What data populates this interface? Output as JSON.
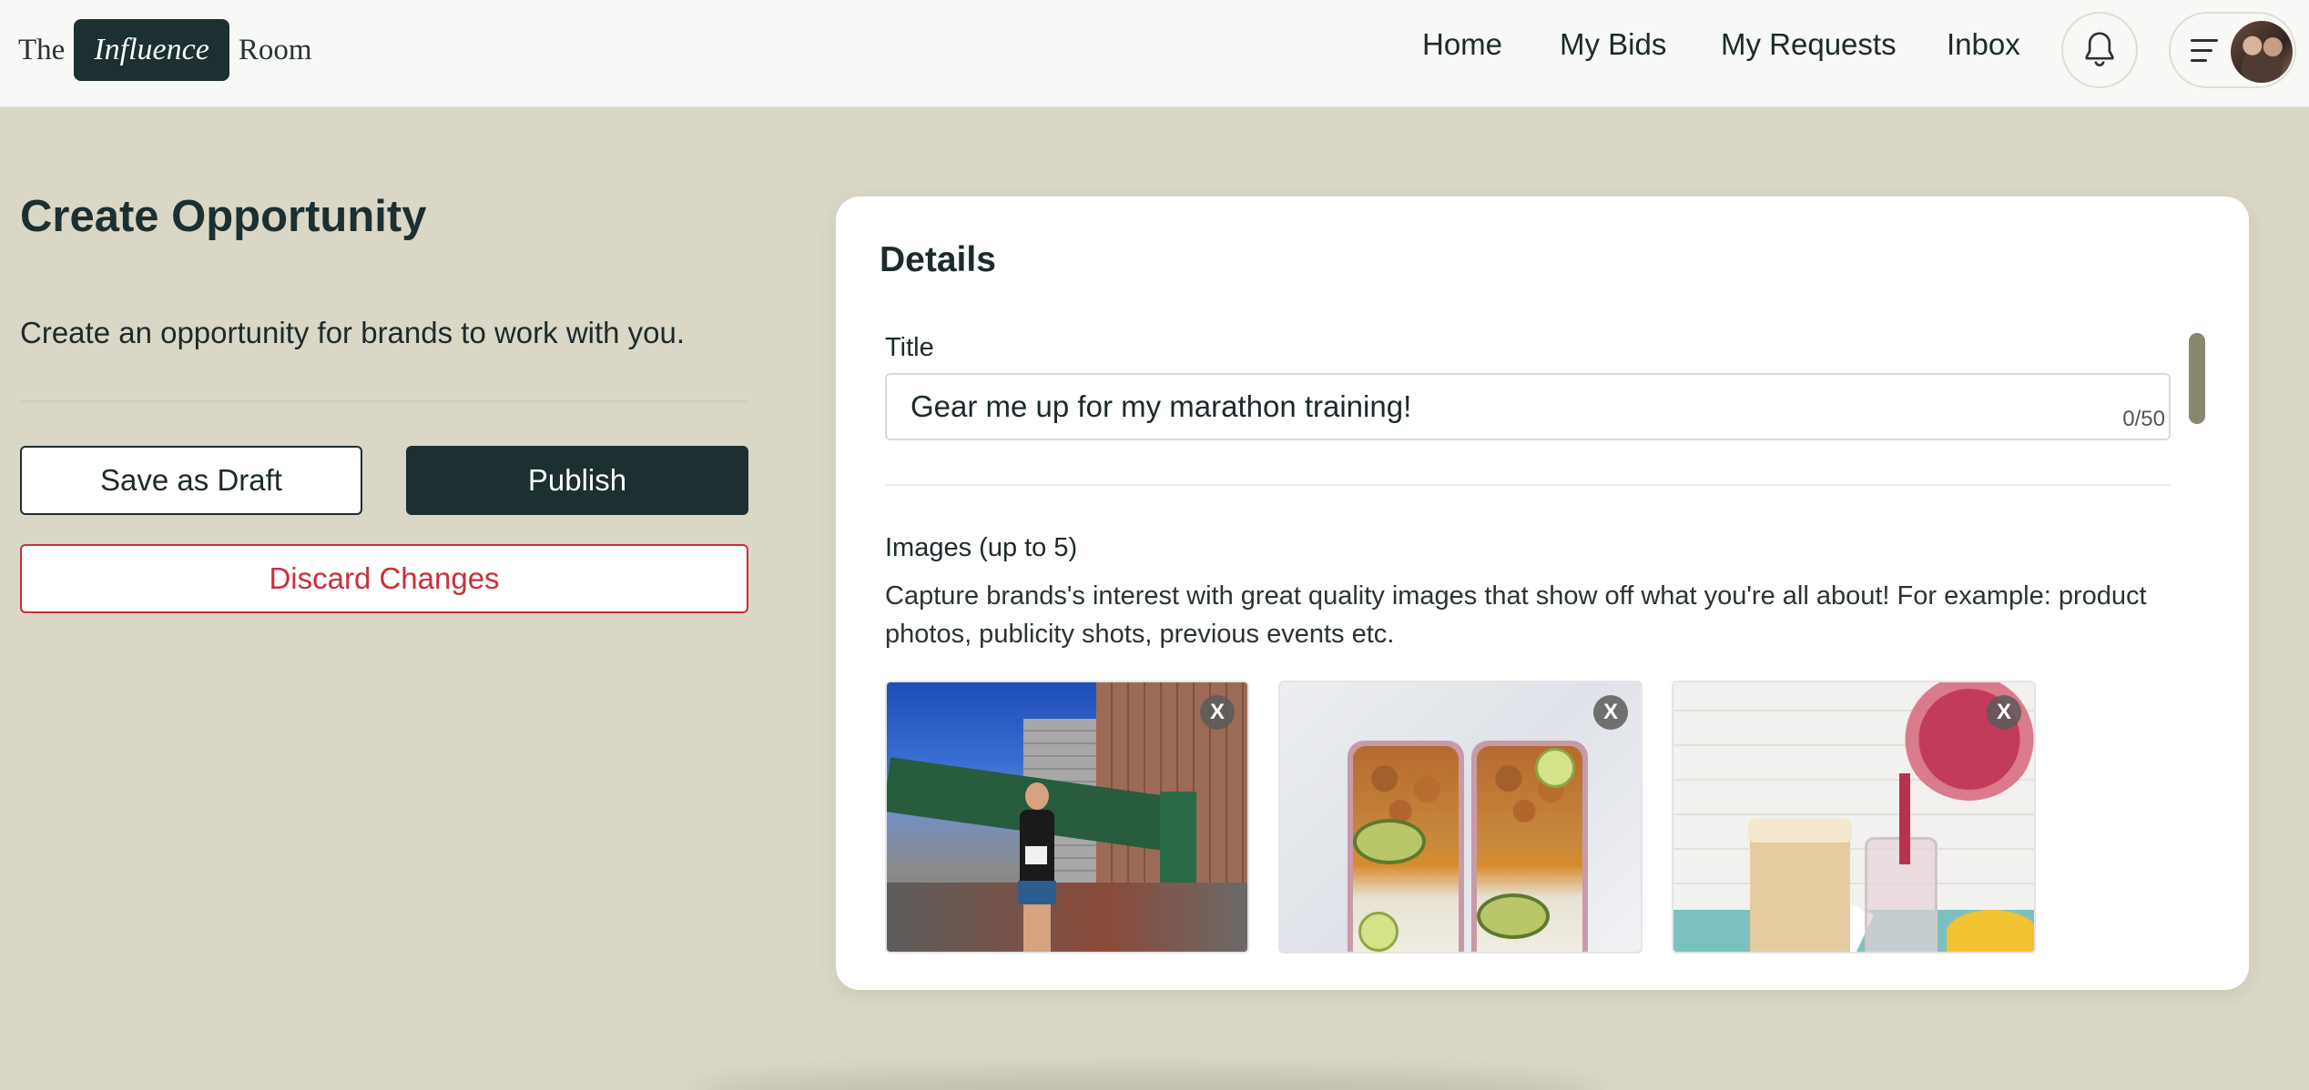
{
  "brand": {
    "prefix": "The",
    "highlight": "Influence",
    "suffix": "Room"
  },
  "nav": {
    "items": [
      {
        "label": "Home"
      },
      {
        "label": "My Bids"
      },
      {
        "label": "My Requests"
      },
      {
        "label": "Inbox"
      }
    ],
    "icons": [
      "bell-icon",
      "hamburger-menu-icon",
      "avatar"
    ]
  },
  "page": {
    "title": "Create Opportunity",
    "subtitle": "Create an opportunity for brands to work with you."
  },
  "actions": {
    "save_draft": "Save as Draft",
    "publish": "Publish",
    "discard": "Discard Changes"
  },
  "details": {
    "heading": "Details",
    "title_label": "Title",
    "title_value": "Gear me up for my marathon training!",
    "title_counter": "0/50",
    "images_label": "Images (up to 5)",
    "images_help": "Capture brands's interest with great quality images that show off what you're all about! For example: product photos, publicity shots, previous events etc.",
    "images": [
      {
        "description": "runner-marathon-finish-photo",
        "remove_label": "X"
      },
      {
        "description": "meal-prep-containers-photo",
        "remove_label": "X"
      },
      {
        "description": "protein-smoothie-photo",
        "remove_label": "X"
      }
    ]
  },
  "colors": {
    "page_bg": "#dbd7c6",
    "primary": "#1c2f31",
    "danger": "#c9303a",
    "card_bg": "#ffffff"
  }
}
